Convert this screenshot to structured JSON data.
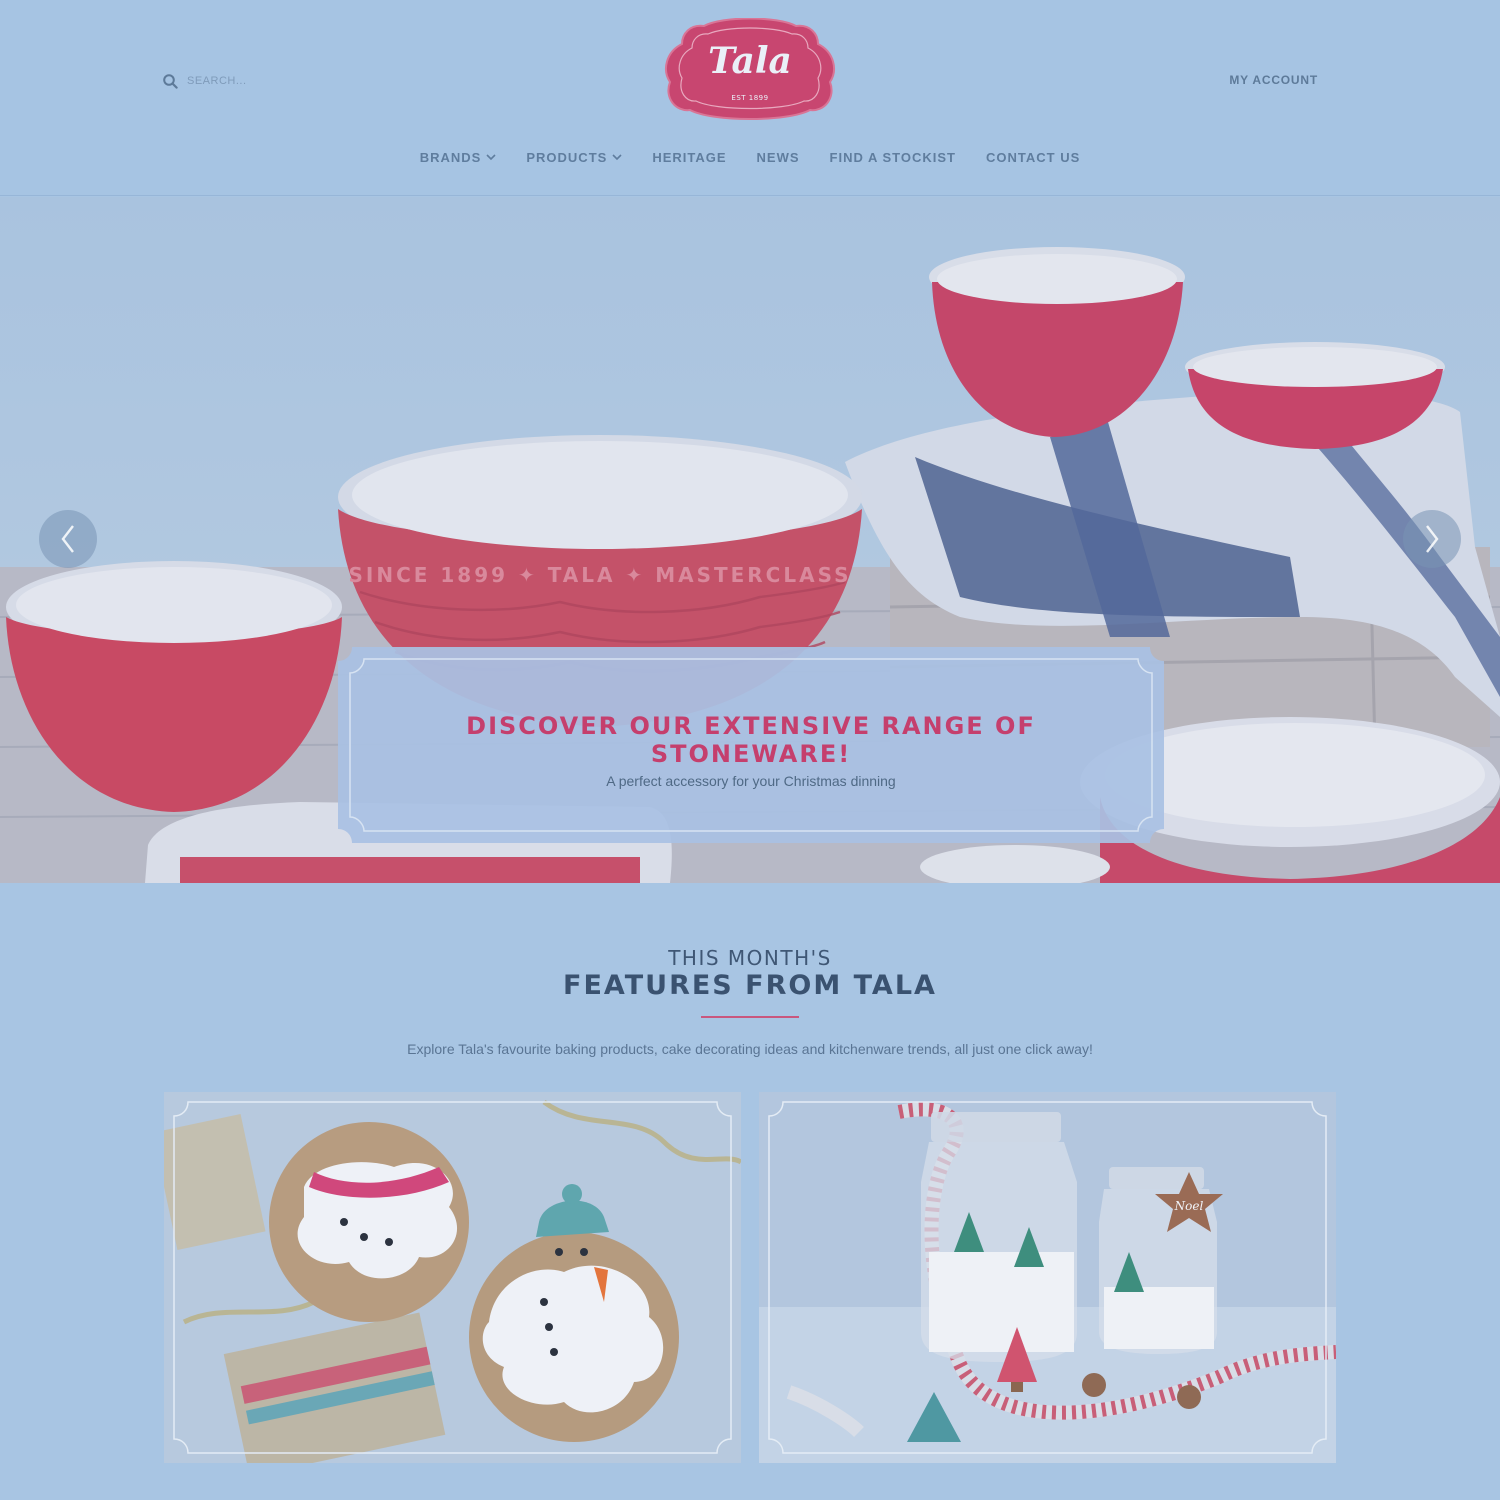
{
  "header": {
    "search_placeholder": "SEARCH...",
    "logo_word": "Tala",
    "logo_est": "EST 1899",
    "account_label": "MY ACCOUNT"
  },
  "nav": {
    "items": [
      {
        "label": "BRANDS",
        "has_dropdown": true
      },
      {
        "label": "PRODUCTS",
        "has_dropdown": true
      },
      {
        "label": "HERITAGE",
        "has_dropdown": false
      },
      {
        "label": "NEWS",
        "has_dropdown": false
      },
      {
        "label": "FIND A STOCKIST",
        "has_dropdown": false
      },
      {
        "label": "CONTACT US",
        "has_dropdown": false
      }
    ]
  },
  "hero": {
    "title": "DISCOVER OUR EXTENSIVE RANGE OF STONEWARE!",
    "subtitle": "A perfect accessory for your Christmas dinning",
    "bowl_lettering": "SINCE 1899 ✦ TALA ✦ MASTERCLASS",
    "prev_icon": "chevron-left-icon",
    "next_icon": "chevron-right-icon"
  },
  "features": {
    "kicker": "THIS MONTH'S",
    "title": "FEATURES FROM TALA",
    "description": "Explore Tala's favourite baking products, cake decorating ideas and kitchenware trends, all just one click away!",
    "cards": [
      {
        "subject": "gingerbread-snowman-cookies"
      },
      {
        "subject": "christmas-jars-with-ribbon",
        "tag_text": "Noel"
      }
    ]
  },
  "colors": {
    "page_bg": "#a8c5e3",
    "brand_pink": "#c53f6d",
    "nav_text": "#5f7d9e",
    "heading": "#3a5270"
  }
}
